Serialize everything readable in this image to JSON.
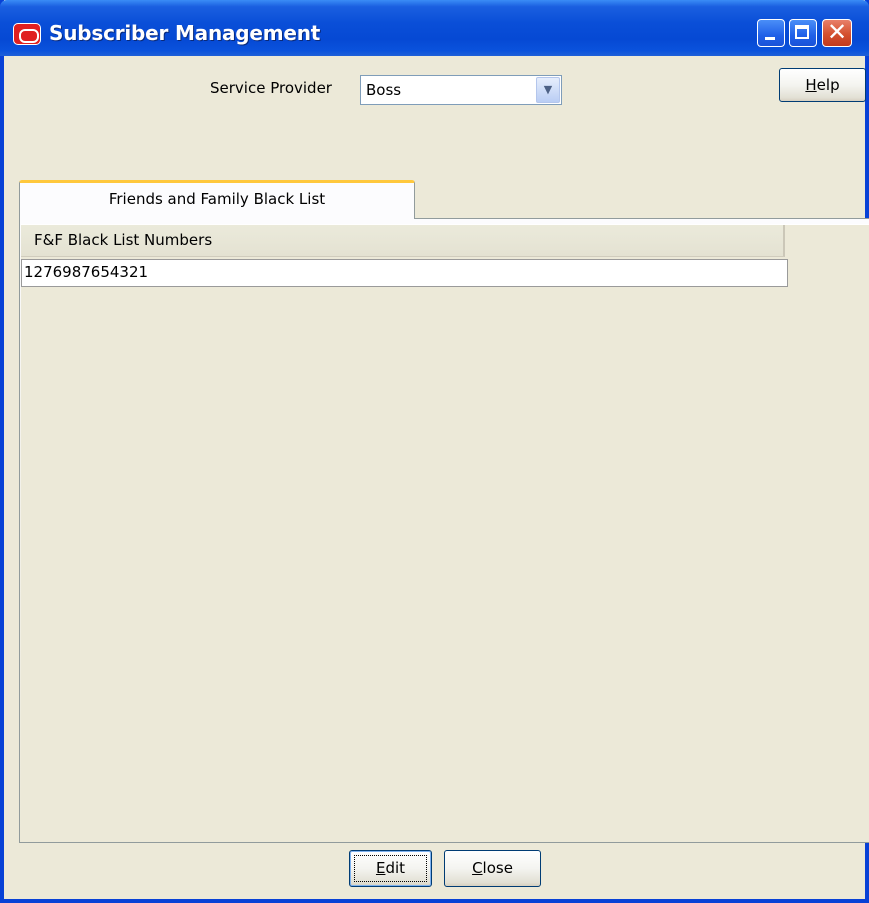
{
  "window": {
    "title": "Subscriber Management",
    "controls": {
      "minimize": "minimize-icon",
      "maximize": "maximize-icon",
      "close": "close-icon",
      "close_glyph": "✕"
    }
  },
  "header": {
    "service_provider_label": "Service Provider",
    "service_provider_value": "Boss",
    "dropdown_arrow": "▼",
    "help_label": "Help",
    "help_label_first": "H",
    "help_label_rest": "elp"
  },
  "tabs": [
    {
      "label": "Friends and Family Black List",
      "selected": true
    }
  ],
  "table": {
    "columns": [
      "F&F Black List Numbers"
    ],
    "rows": [
      [
        "1276987654321"
      ]
    ]
  },
  "footer": {
    "edit_label": "Edit",
    "edit_label_first": "E",
    "edit_label_rest": "dit",
    "close_label": "Close",
    "close_label_first": "C",
    "close_label_rest": "lose"
  },
  "colors": {
    "titlebar": "#0649d4",
    "window_bg": "#ece9d8",
    "tab_accent": "#ffc83c",
    "close_button": "#d4502e"
  }
}
